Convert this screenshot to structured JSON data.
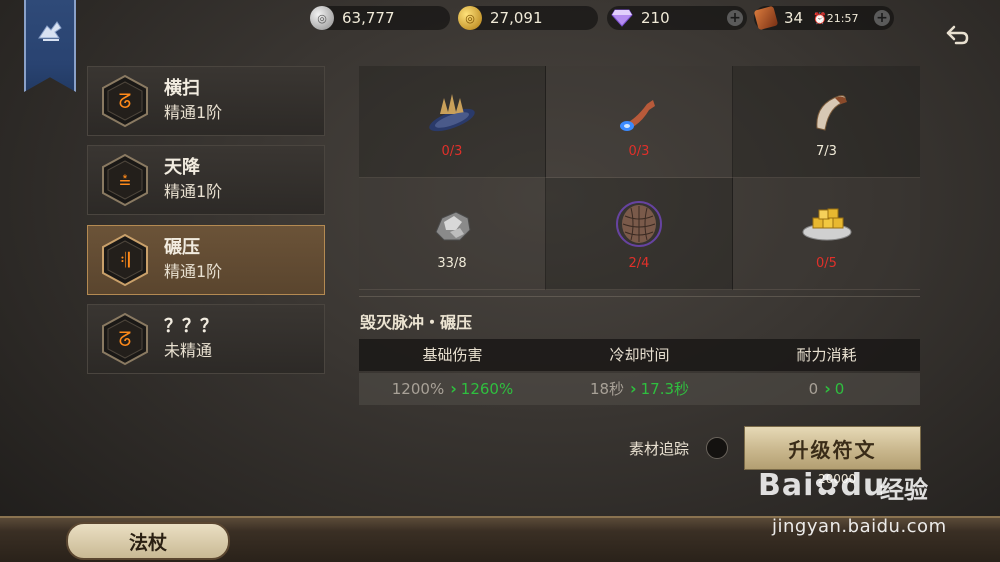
{
  "currencies": {
    "silver": "63,777",
    "gold": "27,091",
    "gems": "210",
    "stamina": "34",
    "stamina_timer": "21:57"
  },
  "skills": [
    {
      "name": "横扫",
      "level": "精通1阶",
      "glyph": "ᘔ",
      "active": false
    },
    {
      "name": "天降",
      "level": "精通1阶",
      "glyph": "⩮",
      "active": false
    },
    {
      "name": "碾压",
      "level": "精通1阶",
      "glyph": "𝄇",
      "active": true
    },
    {
      "name": "？？？",
      "level": "未精通",
      "glyph": "ᘔ",
      "active": false
    }
  ],
  "materials": [
    {
      "count": "0/3",
      "sufficient": false,
      "icon": "spiked-bracer-icon"
    },
    {
      "count": "0/3",
      "sufficient": false,
      "icon": "blue-gem-arm-icon"
    },
    {
      "count": "7/3",
      "sufficient": true,
      "icon": "curved-fang-icon"
    },
    {
      "count": "33/8",
      "sufficient": true,
      "icon": "silver-ore-icon"
    },
    {
      "count": "2/4",
      "sufficient": false,
      "icon": "scaled-cone-icon"
    },
    {
      "count": "0/5",
      "sufficient": false,
      "icon": "gold-ingot-bowl-icon"
    }
  ],
  "skill_detail": {
    "title": "毁灭脉冲・碾压",
    "headers": [
      "基础伤害",
      "冷却时间",
      "耐力消耗"
    ],
    "stats": [
      {
        "from": "1200%",
        "to": "1260%"
      },
      {
        "from": "18秒",
        "to": "17.3秒"
      },
      {
        "from": "0",
        "to": "0"
      }
    ]
  },
  "tracking": {
    "label": "素材追踪"
  },
  "upgrade": {
    "label": "升级符文",
    "cost": "20000"
  },
  "bottom": {
    "tab_label": "法杖"
  },
  "watermark": {
    "logo": "Bai",
    "logo_tail": "du",
    "sub": "经验",
    "url": "jingyan.baidu.com"
  },
  "colors": {
    "insufficient": "#e0302a",
    "increase": "#2fbf3f",
    "accent": "#b48a52"
  }
}
